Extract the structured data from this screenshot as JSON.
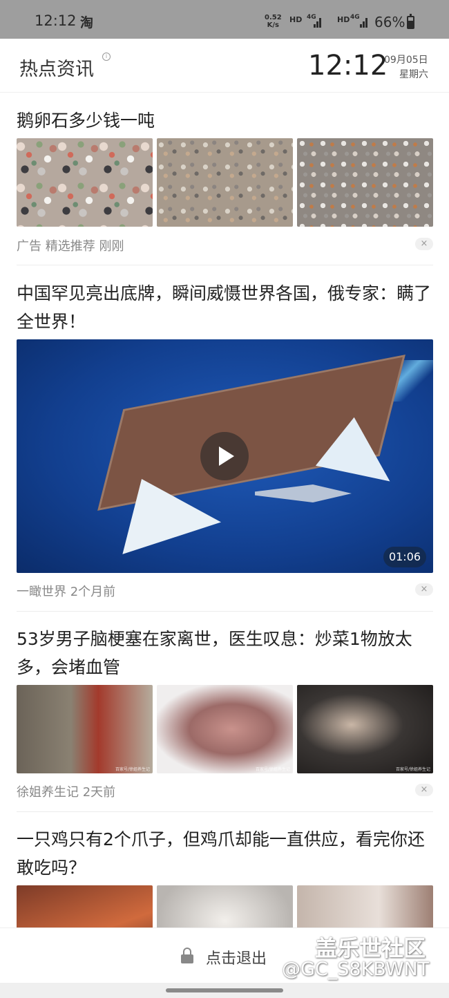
{
  "status_bar": {
    "time": "12:12",
    "app_icon": "淘",
    "net_speed_value": "0.52",
    "net_speed_unit": "K/s",
    "net1_label": "HD",
    "net1_type": "4G",
    "net2_label": "HD",
    "net2_type": "4G",
    "battery": "66%",
    "battery_level": 0.66
  },
  "header": {
    "title": "热点资讯",
    "info_glyph": "i",
    "clock": "12:12",
    "date": "09月05日",
    "weekday": "星期六"
  },
  "articles": [
    {
      "title": "鹅卵石多少钱一吨",
      "meta": "广告  精选推荐  刚刚",
      "close": "×"
    },
    {
      "title": "中国罕见亮出底牌，瞬间威慑世界各国，俄专家：瞒了全世界！",
      "meta": "一瞰世界  2个月前",
      "duration": "01:06",
      "close": "×"
    },
    {
      "title": "53岁男子脑梗塞在家离世，医生叹息：炒菜1物放太多，会堵血管",
      "meta": "徐姐养生记  2天前",
      "image_watermark": "百家号/徐姐养生记",
      "close": "×"
    },
    {
      "title": "一只鸡只有2个爪子，但鸡爪却能一直供应，看完你还敢吃吗？"
    }
  ],
  "bottom_bar": {
    "exit_label": "点击退出",
    "watermark_brand": "盖乐世社区",
    "watermark_user": "@GC_S8KBWNT"
  },
  "colors": {
    "status_bar_bg": "#9e9e9e",
    "meta_text": "#888888",
    "title_text": "#222222"
  }
}
